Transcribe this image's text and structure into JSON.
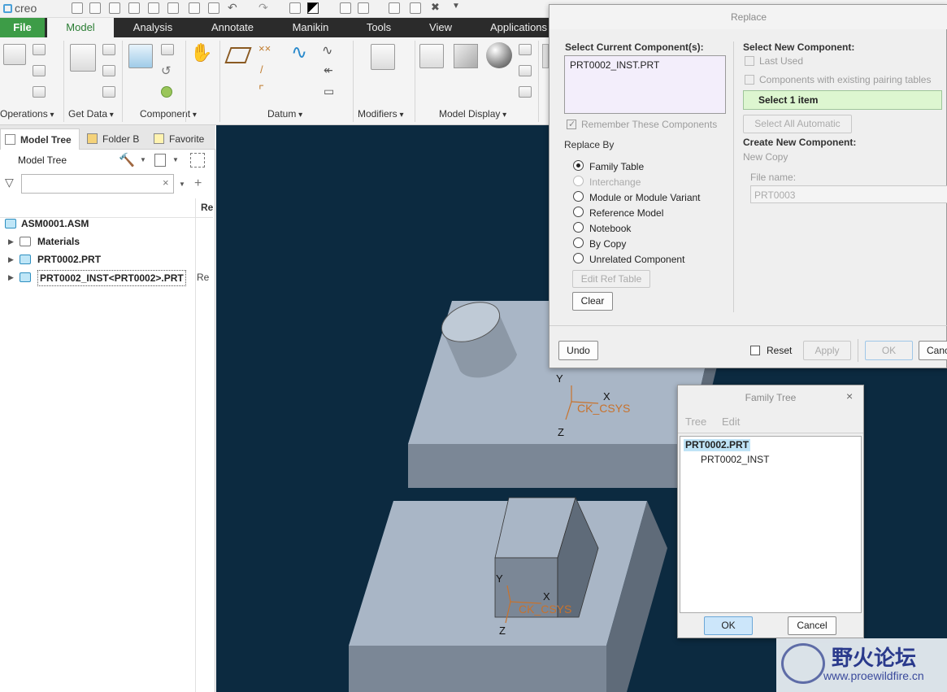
{
  "app": {
    "logo_text": "creo",
    "menu_tabs": [
      "File",
      "Model",
      "Analysis",
      "Annotate",
      "Manikin",
      "Tools",
      "View",
      "Applications"
    ]
  },
  "ribbon": {
    "groups": [
      "Operations",
      "Get Data",
      "Component",
      "Datum",
      "Modifiers",
      "Model Display"
    ]
  },
  "nav": {
    "tabs": [
      "Model Tree",
      "Folder B",
      "Favorite"
    ],
    "panel_title": "Model Tree",
    "search_value": "",
    "column_header": "Re",
    "items": [
      {
        "label": "ASM0001.ASM",
        "extra": ""
      },
      {
        "label": "Materials",
        "extra": ""
      },
      {
        "label": "PRT0002.PRT",
        "extra": ""
      },
      {
        "label": "PRT0002_INST<PRT0002>.PRT",
        "extra": "Re"
      }
    ]
  },
  "viewport": {
    "csys1": {
      "y": "Y",
      "x": "X",
      "z": "Z",
      "name": "CK_CSYS"
    },
    "csys2": {
      "y": "Y",
      "x": "X",
      "z": "Z",
      "name": "CK_CSYS"
    }
  },
  "replace_dialog": {
    "title": "Replace",
    "select_current_label": "Select Current Component(s):",
    "current_item": "PRT0002_INST.PRT",
    "remember_label": "Remember These Components",
    "replace_by_label": "Replace By",
    "options": [
      {
        "label": "Family Table",
        "selected": true,
        "disabled": false
      },
      {
        "label": "Interchange",
        "selected": false,
        "disabled": true
      },
      {
        "label": "Module or Module Variant",
        "selected": false,
        "disabled": false
      },
      {
        "label": "Reference Model",
        "selected": false,
        "disabled": false
      },
      {
        "label": "Notebook",
        "selected": false,
        "disabled": false
      },
      {
        "label": "By Copy",
        "selected": false,
        "disabled": false
      },
      {
        "label": "Unrelated Component",
        "selected": false,
        "disabled": false
      }
    ],
    "edit_ref_table": "Edit Ref Table",
    "clear": "Clear",
    "select_new_label": "Select New Component:",
    "last_used": "Last Used",
    "components_pairing": "Components with existing pairing tables",
    "select_item": "Select 1 item",
    "select_all_auto": "Select All Automatic",
    "create_new_label": "Create New Component:",
    "new_copy": "New Copy",
    "file_name_label": "File name:",
    "file_name_value": "PRT0003",
    "undo": "Undo",
    "reset": "Reset",
    "apply": "Apply",
    "ok": "OK",
    "cancel": "Canc"
  },
  "family_dialog": {
    "title": "Family Tree",
    "menu": [
      "Tree",
      "Edit"
    ],
    "items": [
      "PRT0002.PRT",
      "PRT0002_INST"
    ],
    "ok": "OK",
    "cancel": "Cancel"
  },
  "watermark": {
    "cn": "野火论坛",
    "url": "www.proewildfire.cn"
  },
  "colors": {
    "viewport_bg": "#0c2a40",
    "part_face": "#a9b6c6",
    "accent_green": "#3d9c47",
    "csys": "#c8722c",
    "select_green": "#ddf6d0"
  }
}
